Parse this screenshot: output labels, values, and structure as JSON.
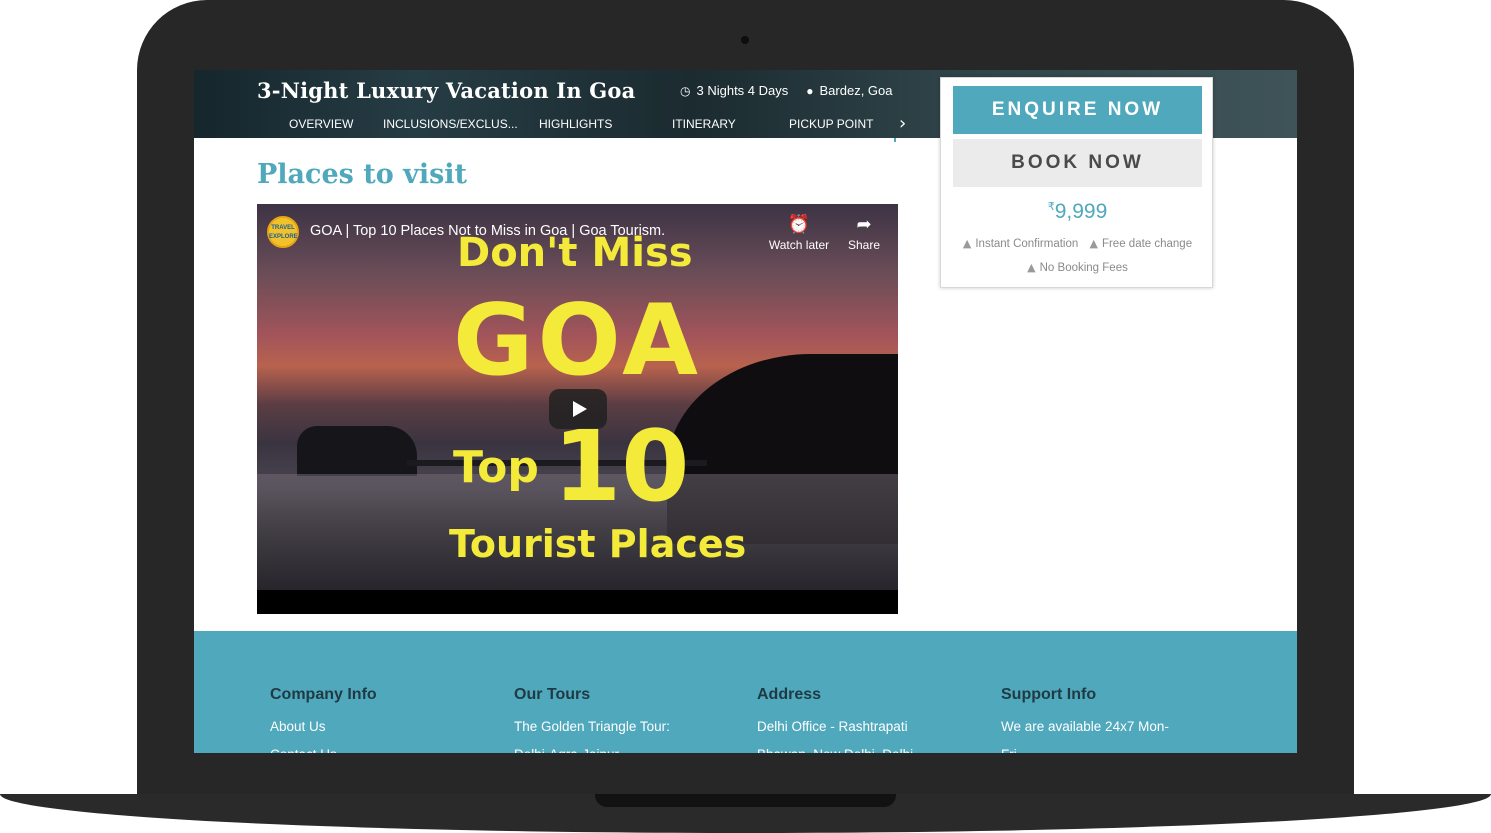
{
  "hero": {
    "title": "3-Night Luxury Vacation In Goa",
    "duration_icon": "clock-icon",
    "duration": "3 Nights 4 Days",
    "location_icon": "map-pin-icon",
    "location": "Bardez, Goa",
    "tabs": [
      "OVERVIEW",
      "INCLUSIONS/EXCLUS...",
      "HIGHLIGHTS",
      "ITINERARY",
      "PICKUP POINT"
    ],
    "next_icon": "chevron-right-icon"
  },
  "section": {
    "title": "Places to visit"
  },
  "video": {
    "title": "GOA | Top 10 Places Not to Miss in Goa | Goa Tourism.",
    "channel_avatar_text": "TRAVEL EXPLORE",
    "watch_later_label": "Watch later",
    "share_label": "Share",
    "thumbnail_text": {
      "line1": "Don't Miss",
      "line2": "GOA",
      "line3": "Top",
      "line4": "10",
      "line5": "Tourist Places"
    }
  },
  "booking": {
    "enquire_label": "ENQUIRE NOW",
    "book_label": "BOOK NOW",
    "currency": "₹",
    "price": "9,999",
    "perks": [
      "Instant Confirmation",
      "Free date change",
      "No Booking Fees"
    ]
  },
  "footer": {
    "columns": [
      {
        "heading": "Company Info",
        "links": [
          "About Us",
          "Contact Us"
        ]
      },
      {
        "heading": "Our Tours",
        "links": [
          "The Golden Triangle Tour:",
          "Delhi-Agra-Jaipur"
        ]
      },
      {
        "heading": "Address",
        "links": [
          "Delhi Office - Rashtrapati",
          "Bhawan, New Delhi, Delhi"
        ]
      },
      {
        "heading": "Support Info",
        "links": [
          "We are available 24x7 Mon-",
          "Fri"
        ]
      }
    ]
  },
  "colors": {
    "accent": "#4fa8bc",
    "frame": "#272727",
    "footer_heading": "#1f3a44"
  }
}
